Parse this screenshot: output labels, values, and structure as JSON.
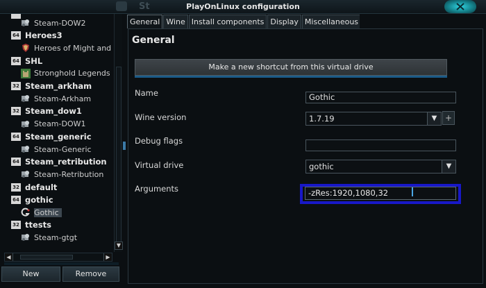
{
  "window": {
    "title": "PlayOnLinux configuration",
    "bg_title_fragment": "St"
  },
  "tree": {
    "top_clipped": {
      "badge": "",
      "label": ""
    },
    "items": [
      {
        "type": "child",
        "icon": "steam-icon",
        "label": "Steam-DOW2"
      },
      {
        "type": "parent",
        "badge": "64",
        "label": "Heroes3"
      },
      {
        "type": "child",
        "icon": "shield-icon",
        "label": "Heroes of Might and"
      },
      {
        "type": "parent",
        "badge": "64",
        "label": "SHL"
      },
      {
        "type": "child",
        "icon": "castle-icon",
        "label": "Stronghold Legends"
      },
      {
        "type": "parent",
        "badge": "32",
        "label": "Steam_arkham"
      },
      {
        "type": "child",
        "icon": "steam-icon",
        "label": "Steam-Arkham"
      },
      {
        "type": "parent",
        "badge": "32",
        "label": "Steam_dow1"
      },
      {
        "type": "child",
        "icon": "steam-icon",
        "label": "Steam-DOW1"
      },
      {
        "type": "parent",
        "badge": "64",
        "label": "Steam_generic"
      },
      {
        "type": "child",
        "icon": "steam-icon",
        "label": "Steam-Generic"
      },
      {
        "type": "parent",
        "badge": "64",
        "label": "Steam_retribution"
      },
      {
        "type": "child",
        "icon": "steam-icon",
        "label": "Steam-Retribution"
      },
      {
        "type": "parent",
        "badge": "32",
        "label": "default"
      },
      {
        "type": "parent",
        "badge": "64",
        "label": "gothic"
      },
      {
        "type": "child",
        "icon": "gothic-icon",
        "label": "Gothic",
        "selected": true
      },
      {
        "type": "parent",
        "badge": "32",
        "label": "ttests"
      },
      {
        "type": "child",
        "icon": "steam-icon",
        "label": "Steam-gtgt"
      }
    ],
    "new_label": "New",
    "remove_label": "Remove"
  },
  "tabs": [
    {
      "label": "General",
      "active": true
    },
    {
      "label": "Wine",
      "active": false
    },
    {
      "label": "Install components",
      "active": false
    },
    {
      "label": "Display",
      "active": false
    },
    {
      "label": "Miscellaneous",
      "active": false
    }
  ],
  "general": {
    "title": "General",
    "shortcut_button": "Make a new shortcut from this virtual drive",
    "name_label": "Name",
    "name_value": "Gothic",
    "wine_version_label": "Wine version",
    "wine_version_value": "1.7.19",
    "debug_flags_label": "Debug flags",
    "debug_flags_value": "",
    "virtual_drive_label": "Virtual drive",
    "virtual_drive_value": "gothic",
    "arguments_label": "Arguments",
    "arguments_value": "-zRes:1920,1080,32"
  },
  "colors": {
    "highlight": "#1818c8",
    "accent": "#1b5b88",
    "background": "#0b0f12"
  }
}
